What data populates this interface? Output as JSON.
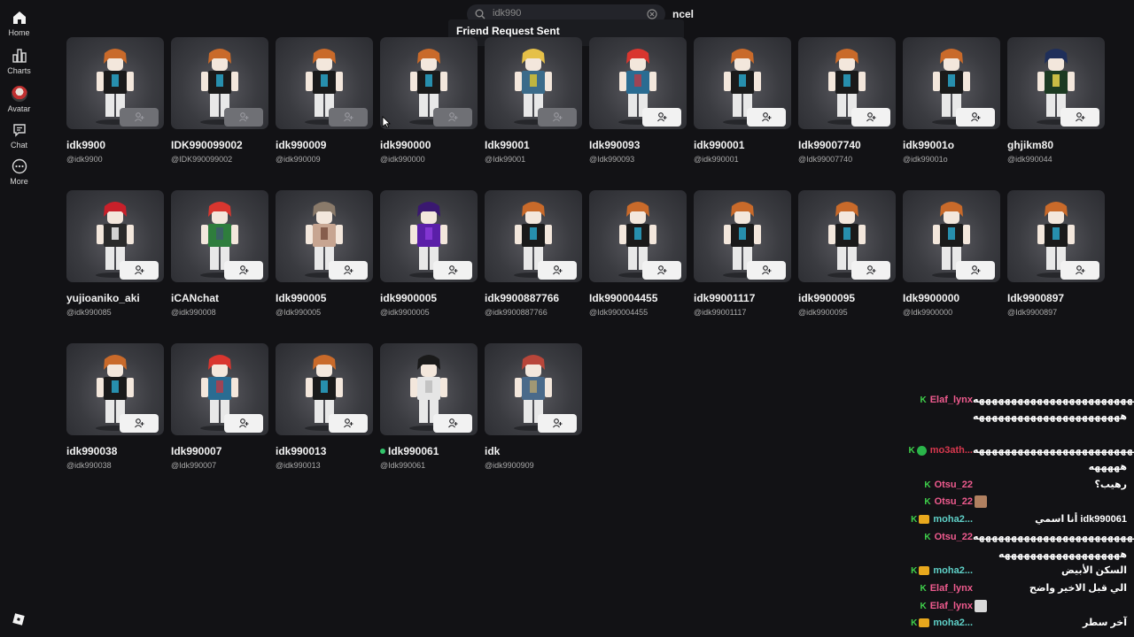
{
  "sidebar": {
    "items": [
      {
        "label": "Home",
        "icon": "home-icon"
      },
      {
        "label": "Charts",
        "icon": "charts-icon"
      },
      {
        "label": "Avatar",
        "icon": "avatar-icon"
      },
      {
        "label": "Chat",
        "icon": "chat-icon"
      },
      {
        "label": "More",
        "icon": "more-icon"
      }
    ]
  },
  "search": {
    "value": "idk990",
    "cancel_label": "ncel"
  },
  "toast": {
    "message": "Friend Request Sent"
  },
  "results": [
    {
      "name": "idk9900",
      "handle": "@idk9900",
      "sent": true
    },
    {
      "name": "IDK990099002",
      "handle": "@IDK990099002",
      "sent": true
    },
    {
      "name": "idk990009",
      "handle": "@idk990009",
      "sent": true
    },
    {
      "name": "idk990000",
      "handle": "@idk990000",
      "sent": true
    },
    {
      "name": "Idk99001",
      "handle": "@Idk99001",
      "sent": true
    },
    {
      "name": "Idk990093",
      "handle": "@Idk990093",
      "sent": false
    },
    {
      "name": "idk990001",
      "handle": "@idk990001",
      "sent": false
    },
    {
      "name": "Idk99007740",
      "handle": "@Idk99007740",
      "sent": false
    },
    {
      "name": "idk99001o",
      "handle": "@idk99001o",
      "sent": false
    },
    {
      "name": "ghjikm80",
      "handle": "@idk990044",
      "sent": false
    },
    {
      "name": "yujioaniko_aki",
      "handle": "@idk990085",
      "sent": false
    },
    {
      "name": "iCANchat",
      "handle": "@idk990008",
      "sent": false
    },
    {
      "name": "Idk990005",
      "handle": "@Idk990005",
      "sent": false
    },
    {
      "name": "idk9900005",
      "handle": "@idk9900005",
      "sent": false
    },
    {
      "name": "idk9900887766",
      "handle": "@idk9900887766",
      "sent": false
    },
    {
      "name": "Idk990004455",
      "handle": "@Idk990004455",
      "sent": false
    },
    {
      "name": "idk99001117",
      "handle": "@idk99001117",
      "sent": false
    },
    {
      "name": "idk9900095",
      "handle": "@idk9900095",
      "sent": false
    },
    {
      "name": "Idk9900000",
      "handle": "@Idk9900000",
      "sent": false
    },
    {
      "name": "Idk9900897",
      "handle": "@Idk9900897",
      "sent": false
    },
    {
      "name": "idk990038",
      "handle": "@idk990038",
      "sent": false
    },
    {
      "name": "Idk990007",
      "handle": "@Idk990007",
      "sent": false
    },
    {
      "name": "idk990013",
      "handle": "@idk990013",
      "sent": false
    },
    {
      "name": "Idk990061",
      "handle": "@Idk990061",
      "sent": false,
      "online": true
    },
    {
      "name": "idk",
      "handle": "@idk9900909",
      "sent": false
    }
  ],
  "chat": {
    "colors": {
      "pink": "#ef5b8e",
      "teal": "#5fd1c8",
      "red": "#d8384e"
    },
    "messages": [
      {
        "user": "Elaf_lynx",
        "text": "هههههههههههههههههههههههههههههههه",
        "cont": [
          "هههههههههههههههههههههههه"
        ],
        "color": "pink"
      },
      {
        "user": "mo3ath...",
        "text": "هههههههههههههههههههههههههههههههه",
        "cont": [
          "هههههه"
        ],
        "color": "red"
      },
      {
        "user": "Otsu_22",
        "text": "رهيب؟",
        "color": "pink"
      },
      {
        "user": "Otsu_22",
        "text": "",
        "color": "pink"
      },
      {
        "user": "moha2...",
        "text": "أنا اسمي idk990061",
        "color": "teal"
      },
      {
        "user": "Otsu_22",
        "text": "هههههههههههههههههههههههههههههههه",
        "cont": [
          "هههههههههههههههههههه"
        ],
        "color": "pink"
      },
      {
        "user": "moha2...",
        "text": "السكن الأبيض",
        "color": "teal"
      },
      {
        "user": "Elaf_lynx",
        "text": "الي قبل الاخير واضح",
        "color": "pink"
      },
      {
        "user": "Elaf_lynx",
        "text": "",
        "color": "pink"
      },
      {
        "user": "moha2...",
        "text": "آخر سطر",
        "color": "teal"
      }
    ]
  }
}
